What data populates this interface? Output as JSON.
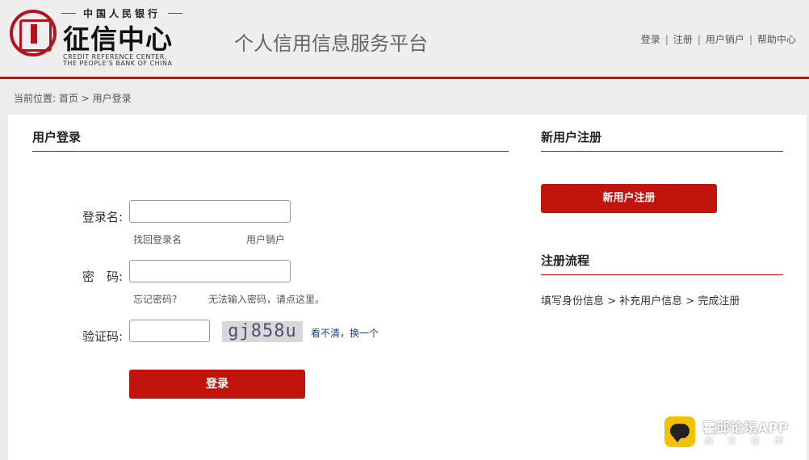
{
  "header": {
    "logo": {
      "top_text": "中国人民银行",
      "main_text": "征信中心",
      "english_line1": "CREDIT REFERENCE CENTER,",
      "english_line2": "THE PEOPLE'S BANK OF CHINA"
    },
    "platform_title": "个人信用信息服务平台",
    "nav": {
      "login": "登录",
      "register": "注册",
      "cancel_account": "用户销户",
      "help_center": "帮助中心",
      "separator": "|"
    }
  },
  "breadcrumb": {
    "prefix": "当前位置:",
    "home": "首页",
    "arrow": ">",
    "current": "用户登录"
  },
  "login": {
    "title": "用户登录",
    "username_label": "登录名:",
    "username_value": "",
    "find_username": "找回登录名",
    "cancel_account": "用户销户",
    "password_label": "密　码:",
    "password_value": "",
    "forgot_password": "忘记密码?",
    "cannot_enter_password": "无法输入密码，请点这里。",
    "captcha_label": "验证码:",
    "captcha_value": "",
    "captcha_image_text": "gj858u",
    "captcha_refresh": "看不清，换一个",
    "submit_label": "登录"
  },
  "register": {
    "title": "新用户注册",
    "button_label": "新用户注册",
    "flow_title": "注册流程",
    "flow_text": "填写身份信息 > 补充用户信息 > 完成注册"
  },
  "watermark": {
    "title": "霍邱论坛APP",
    "subtitle": "阅读霍邱"
  },
  "colors": {
    "accent": "#c0140c",
    "background": "#ececec",
    "panel": "#ffffff"
  }
}
